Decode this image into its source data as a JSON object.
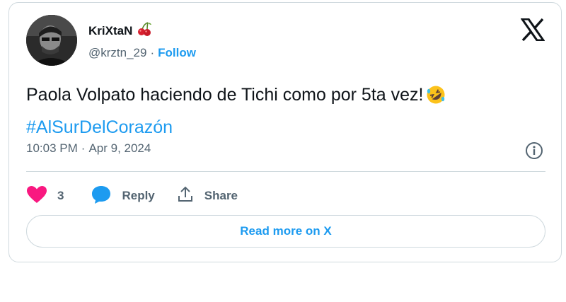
{
  "author": {
    "display_name": "KriXtaN",
    "name_emoji_icon": "cherries-icon",
    "handle": "@krztn_29",
    "separator": "·",
    "follow_label": "Follow"
  },
  "platform_icon": "x-logo-icon",
  "tweet": {
    "text": "Paola Volpato haciendo de Tichi como por 5ta vez!",
    "text_emoji_icon": "rolling-on-floor-laughing-icon",
    "hashtag": "#AlSurDelCorazón",
    "time": "10:03 PM",
    "separator": "·",
    "date": "Apr 9, 2024"
  },
  "actions": {
    "like_count": "3",
    "reply_label": "Reply",
    "share_label": "Share"
  },
  "read_more_label": "Read more on X",
  "colors": {
    "accent": "#1d9bf0",
    "like": "#f91880",
    "text": "#0f1419",
    "secondary_text": "#536471",
    "border": "#cfd9de"
  }
}
